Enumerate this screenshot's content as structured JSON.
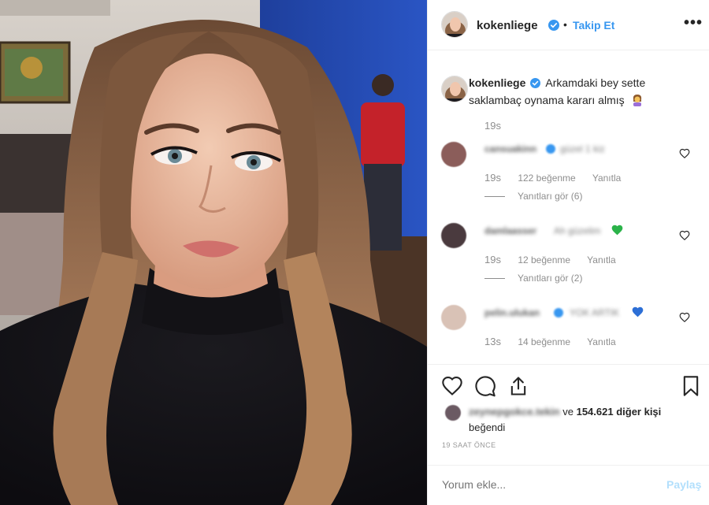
{
  "post": {
    "username": "kokenliege",
    "separator": "•",
    "follow_label": "Takip Et",
    "more_label": "•••",
    "caption": "Arkamdaki bey sette saklambaç oynama kararı almış",
    "caption_time": "19s"
  },
  "comments": [
    {
      "username": "cansuakinn",
      "text": "güzel 1 kiz",
      "time": "19s",
      "likes": "122 beğenme",
      "reply_label": "Yanıtla",
      "view_replies": "Yanıtları gör (6)"
    },
    {
      "username": "damlaasser",
      "text": "Ah güzelim",
      "time": "19s",
      "likes": "12 beğenme",
      "reply_label": "Yanıtla",
      "view_replies": "Yanıtları gör (2)"
    },
    {
      "username": "pelin.ulukan",
      "text": "YOK ARTIK",
      "time": "13s",
      "likes": "14 beğenme",
      "reply_label": "Yanıtla"
    }
  ],
  "likes": {
    "first_user": "zeynepgokce.tekin",
    "connector": "ve",
    "count": "154.621 diğer kişi",
    "suffix": "beğendi"
  },
  "timestamp": "19 SAAT ÖNCE",
  "comment_box": {
    "placeholder": "Yorum ekle...",
    "share_label": "Paylaş"
  },
  "colors": {
    "accent": "#3897f0",
    "verified": "#3897f0",
    "muted": "#8e8e8e",
    "green_heart": "#2bb34a",
    "blue_heart": "#2d6fd6",
    "share_disabled": "#b2dffc"
  },
  "icons": [
    "verified-icon",
    "more-icon",
    "heart-icon",
    "comment-icon",
    "share-icon",
    "bookmark-icon",
    "woman-gesturing-emoji",
    "green-heart-emoji",
    "blue-heart-emoji"
  ]
}
